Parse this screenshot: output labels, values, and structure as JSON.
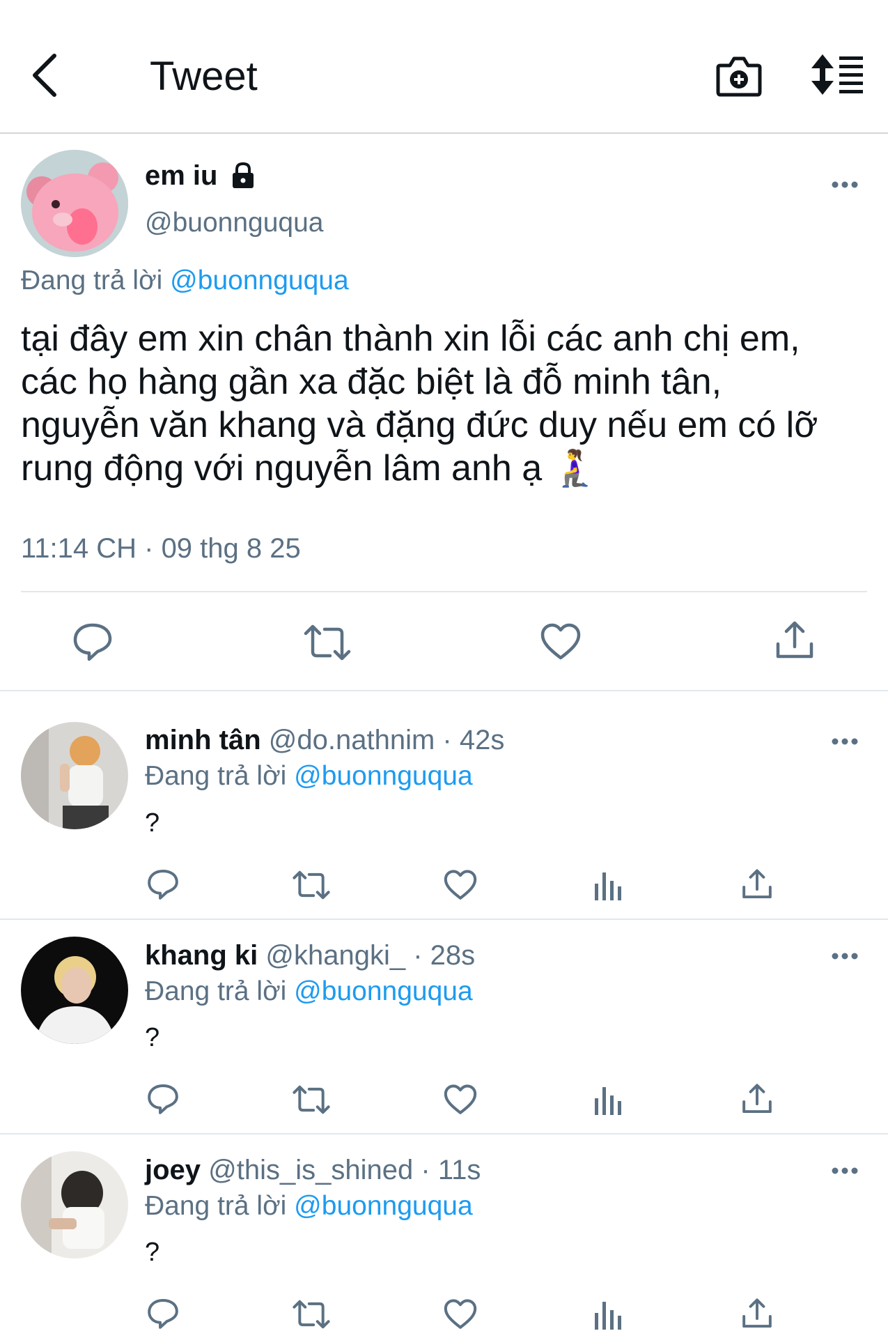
{
  "header": {
    "title": "Tweet"
  },
  "tweet": {
    "name": "em iu",
    "handle": "@buonnguqua",
    "replying_prefix": "Đang trả lời",
    "replying_to": "@buonnguqua",
    "text": "tại đây em xin chân thành xin lỗi các anh chị em,\ncác họ hàng gần xa đặc biệt là đỗ minh tân,\nnguyễn văn khang và đặng đức duy nếu em có lỡ\nrung động với nguyễn lâm anh ạ 🧎‍♀️",
    "timestamp": "11:14 CH · 09 thg 8 25"
  },
  "replies": [
    {
      "name": "minh tân",
      "handle_time": "@do.nathnim · 42s",
      "replying_prefix": "Đang trả lời",
      "replying_to": "@buonnguqua",
      "text": "?"
    },
    {
      "name": "khang ki",
      "handle_time": "@khangki_ · 28s",
      "replying_prefix": "Đang trả lời",
      "replying_to": "@buonnguqua",
      "text": "?"
    },
    {
      "name": "joey",
      "handle_time": "@this_is_shined · 11s",
      "replying_prefix": "Đang trả lời",
      "replying_to": "@buonnguqua",
      "text": "?"
    }
  ],
  "colors": {
    "accent": "#1d9bf0",
    "secondary_text": "#5b7083",
    "divider": "#e1e8ed"
  },
  "icons": [
    "back-arrow-icon",
    "camera-plus-icon",
    "sort-icon",
    "lock-icon",
    "more-icon",
    "reply-icon",
    "retweet-icon",
    "like-icon",
    "views-icon",
    "share-icon"
  ]
}
